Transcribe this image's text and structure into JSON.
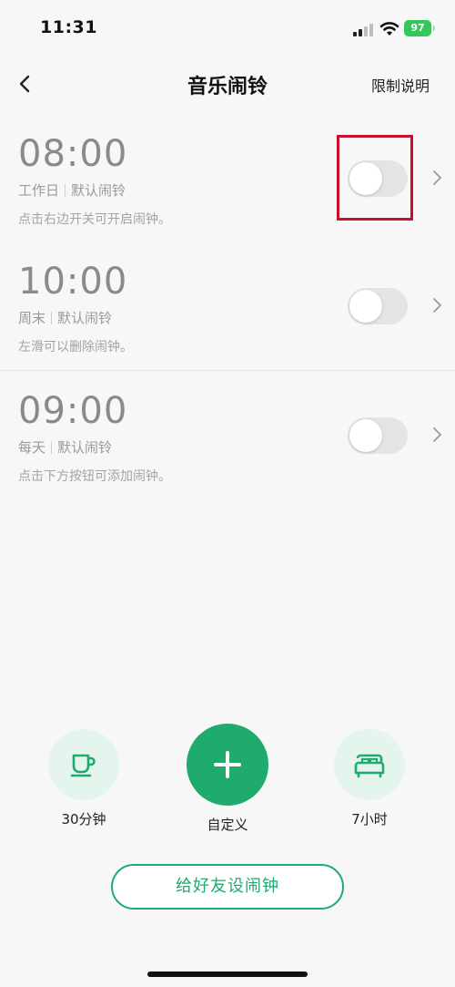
{
  "status_bar": {
    "time": "11:31",
    "battery": "97"
  },
  "nav": {
    "title": "音乐闹铃",
    "action": "限制说明"
  },
  "alarms": [
    {
      "time": "08:00",
      "repeat": "工作日",
      "ringtone": "默认闹铃",
      "hint": "点击右边开关可开启闹钟。",
      "enabled": false
    },
    {
      "time": "10:00",
      "repeat": "周末",
      "ringtone": "默认闹铃",
      "hint": "左滑可以删除闹钟。",
      "enabled": false
    },
    {
      "time": "09:00",
      "repeat": "每天",
      "ringtone": "默认闹铃",
      "hint": "点击下方按钮可添加闹钟。",
      "enabled": false
    }
  ],
  "quick_actions": {
    "nap": "30分钟",
    "custom": "自定义",
    "sleep": "7小时"
  },
  "friend_button": "给好友设闹钟",
  "colors": {
    "accent": "#1faa6e",
    "accent_light": "#e3f5ec",
    "highlight": "#c8102e"
  },
  "icons": {
    "back": "chevron-left-icon",
    "row": "chevron-right-icon",
    "nap": "coffee-cup-icon",
    "custom": "plus-icon",
    "sleep": "bed-icon"
  }
}
